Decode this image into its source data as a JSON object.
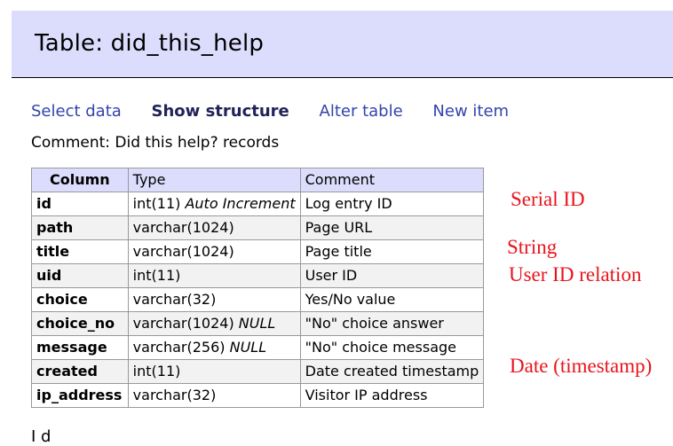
{
  "page_title": "Table: did_this_help",
  "nav": [
    {
      "label": "Select data",
      "active": false
    },
    {
      "label": "Show structure",
      "active": true
    },
    {
      "label": "Alter table",
      "active": false
    },
    {
      "label": "New item",
      "active": false
    }
  ],
  "comment": "Comment: Did this help? records",
  "table": {
    "headers": {
      "column": "Column",
      "type": "Type",
      "comment": "Comment"
    },
    "rows": [
      {
        "column": "id",
        "type": "int(11)",
        "extra": "Auto Increment",
        "comment": "Log entry ID"
      },
      {
        "column": "path",
        "type": "varchar(1024)",
        "extra": "",
        "comment": "Page URL"
      },
      {
        "column": "title",
        "type": "varchar(1024)",
        "extra": "",
        "comment": "Page title"
      },
      {
        "column": "uid",
        "type": "int(11)",
        "extra": "",
        "comment": "User ID"
      },
      {
        "column": "choice",
        "type": "varchar(32)",
        "extra": "",
        "comment": "Yes/No value"
      },
      {
        "column": "choice_no",
        "type": "varchar(1024)",
        "extra": "NULL",
        "comment": "\"No\" choice answer"
      },
      {
        "column": "message",
        "type": "varchar(256)",
        "extra": "NULL",
        "comment": "\"No\" choice message"
      },
      {
        "column": "created",
        "type": "int(11)",
        "extra": "",
        "comment": "Date created timestamp"
      },
      {
        "column": "ip_address",
        "type": "varchar(32)",
        "extra": "",
        "comment": "Visitor IP address"
      }
    ]
  },
  "annotations": {
    "serial_id": "Serial ID",
    "string": "String",
    "user_id_relation": "User ID relation",
    "date_timestamp": "Date (timestamp)"
  },
  "cutoff_text": "I  d"
}
